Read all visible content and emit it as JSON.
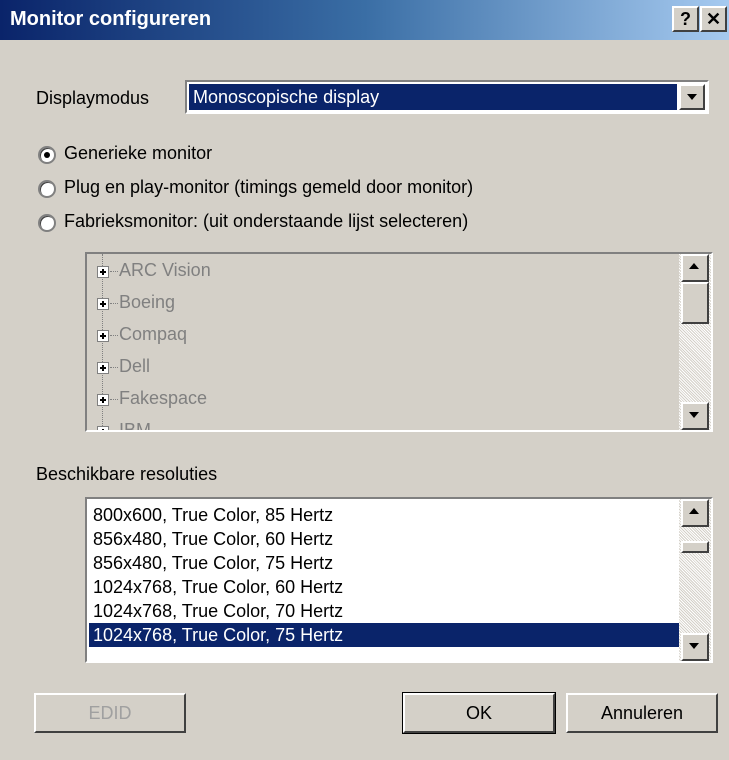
{
  "window": {
    "title": "Monitor configureren",
    "help_label": "?",
    "close_label": "✕"
  },
  "display_mode": {
    "label": "Displaymodus",
    "selected": "Monoscopische display"
  },
  "radios": [
    {
      "label": "Generieke monitor",
      "checked": true
    },
    {
      "label": "Plug en play-monitor (timings gemeld door monitor)",
      "checked": false
    },
    {
      "label": "Fabrieksmonitor: (uit onderstaande lijst selecteren)",
      "checked": false
    }
  ],
  "manufacturers": [
    "ARC Vision",
    "Boeing",
    "Compaq",
    "Dell",
    "Fakespace",
    "IBM"
  ],
  "resolutions": {
    "label": "Beschikbare resoluties",
    "items": [
      "800x600, True Color, 85 Hertz",
      "856x480, True Color, 60 Hertz",
      "856x480, True Color, 75 Hertz",
      "1024x768, True Color, 60 Hertz",
      "1024x768, True Color, 70 Hertz",
      "1024x768, True Color, 75 Hertz"
    ],
    "selected": "1024x768, True Color, 75 Hertz"
  },
  "buttons": {
    "edid": "EDID",
    "ok": "OK",
    "cancel": "Annuleren"
  }
}
